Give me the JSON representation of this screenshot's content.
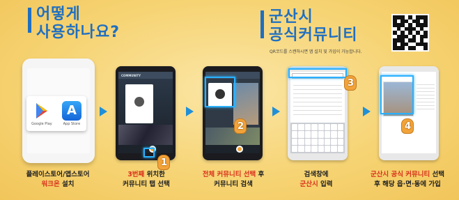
{
  "left_heading": {
    "line1": "어떻게",
    "line2": "사용하나요?"
  },
  "right_heading": {
    "line1": "군산시",
    "line2": "공식커뮤니티",
    "note": "QR코드를 스캔하시면 앱 설치 및 가입이 가능합니다."
  },
  "colors": {
    "accent_blue": "#1f6fc1",
    "highlight_red": "#d9311b",
    "background": "#f6d372"
  },
  "step1": {
    "store_labels": [
      "Google Play",
      "App Store"
    ],
    "caption_line1": "플레이스토어/앱스토어",
    "caption_hl": "워크온",
    "caption_rest": " 설치"
  },
  "step2": {
    "app_title": "COMMUNITY",
    "caption_hl": "3번째",
    "caption_rest1": " 위치한",
    "caption_line2": "커뮤니티 탭 선택",
    "hand_number": "1"
  },
  "step3": {
    "caption_hl": "전체 커뮤니티 선택",
    "caption_rest1": " 후",
    "caption_line2": "커뮤니티 검색",
    "hand_number": "2"
  },
  "step4": {
    "caption_line1": "검색창에",
    "caption_hl": "군산시",
    "caption_rest": " 입력",
    "hand_number": "3"
  },
  "step5": {
    "caption_hl": "군산시 공식 커뮤니티",
    "caption_rest1": " 선택",
    "caption_line2": "후 해당 읍·면·동에 가입",
    "hand_number": "4"
  }
}
